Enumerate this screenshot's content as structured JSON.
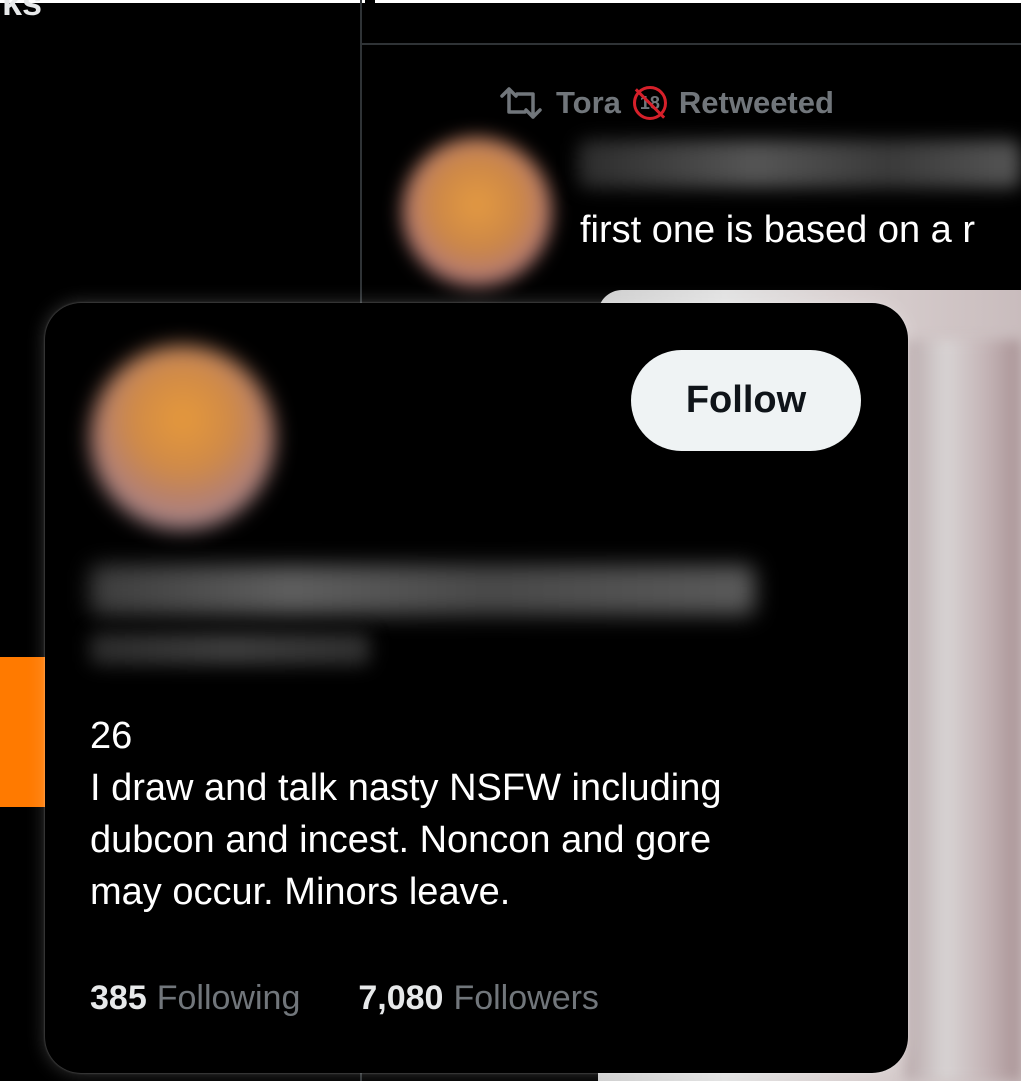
{
  "sidebar": {
    "heading_fragment": "ks"
  },
  "retweet": {
    "icon": "retweet-icon",
    "retweeter": "Tora",
    "badge_text": "18",
    "badge_icon": "no-under-18-icon",
    "action_label": "Retweeted"
  },
  "tweet": {
    "text": "first one is based on a r"
  },
  "hover_card": {
    "follow_label": "Follow",
    "bio_lines": [
      "26",
      "I draw and talk nasty NSFW including",
      "dubcon and incest. Noncon and gore",
      "may occur. Minors leave."
    ],
    "following_count": "385",
    "following_label": "Following",
    "followers_count": "7,080",
    "followers_label": "Followers"
  },
  "colors": {
    "background": "#000000",
    "divider": "#2f3336",
    "muted_text": "#71767b",
    "follow_button_bg": "#eff3f4",
    "accent_orange": "#ff7a00",
    "badge_red": "#d6202a"
  }
}
